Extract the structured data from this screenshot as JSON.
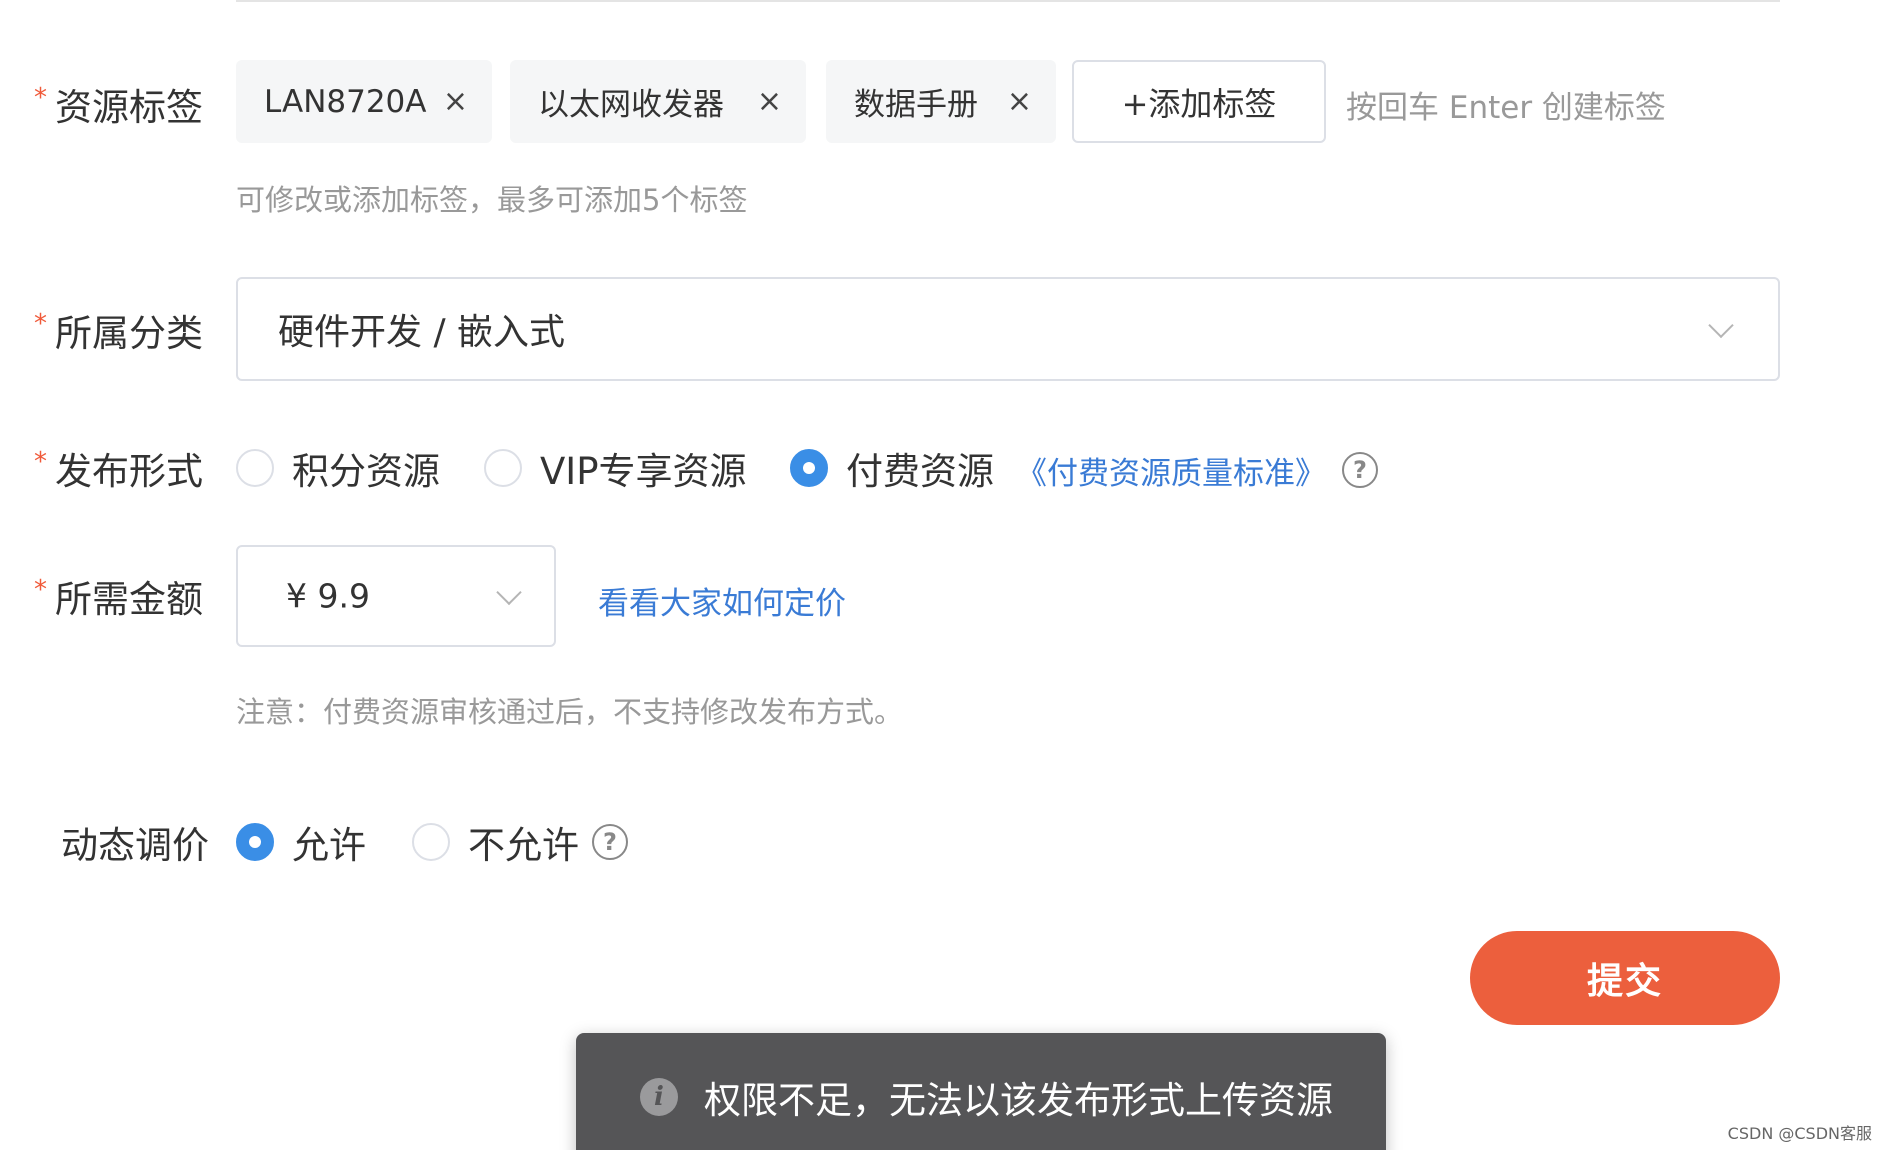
{
  "tags_field": {
    "label": "资源标签",
    "tags": [
      "LAN8720A",
      "以太网收发器",
      "数据手册"
    ],
    "tag_close_glyph": "×",
    "add_button_label": "+添加标签",
    "enter_hint": "按回车 Enter 创建标签",
    "helper_text": "可修改或添加标签，最多可添加5个标签"
  },
  "category_field": {
    "label": "所属分类",
    "value": "硬件开发 / 嵌入式"
  },
  "publish_field": {
    "label": "发布形式",
    "options": [
      "积分资源",
      "VIP专享资源",
      "付费资源"
    ],
    "selected": "付费资源",
    "standard_link": "《付费资源质量标准》"
  },
  "price_field": {
    "label": "所需金额",
    "value": "¥ 9.9",
    "pricing_link": "看看大家如何定价",
    "note": "注意：付费资源审核通过后，不支持修改发布方式。"
  },
  "dynamic_price_field": {
    "label": "动态调价",
    "options": [
      "允许",
      "不允许"
    ],
    "selected": "允许"
  },
  "required_mark": "*",
  "help_glyph": "?",
  "submit_label": "提交",
  "toast": {
    "info_glyph": "i",
    "message": "权限不足，无法以该发布形式上传资源"
  },
  "watermark": "CSDN @CSDN客服",
  "colors": {
    "accent_blue": "#3a8ee6",
    "link_blue": "#3a7bd5",
    "submit_orange": "#ec5f3d",
    "required_red": "#f05a3a",
    "toast_bg": "#555557"
  },
  "icons": [
    "tag-close-icon",
    "chevron-down-icon",
    "help-icon",
    "info-icon"
  ]
}
